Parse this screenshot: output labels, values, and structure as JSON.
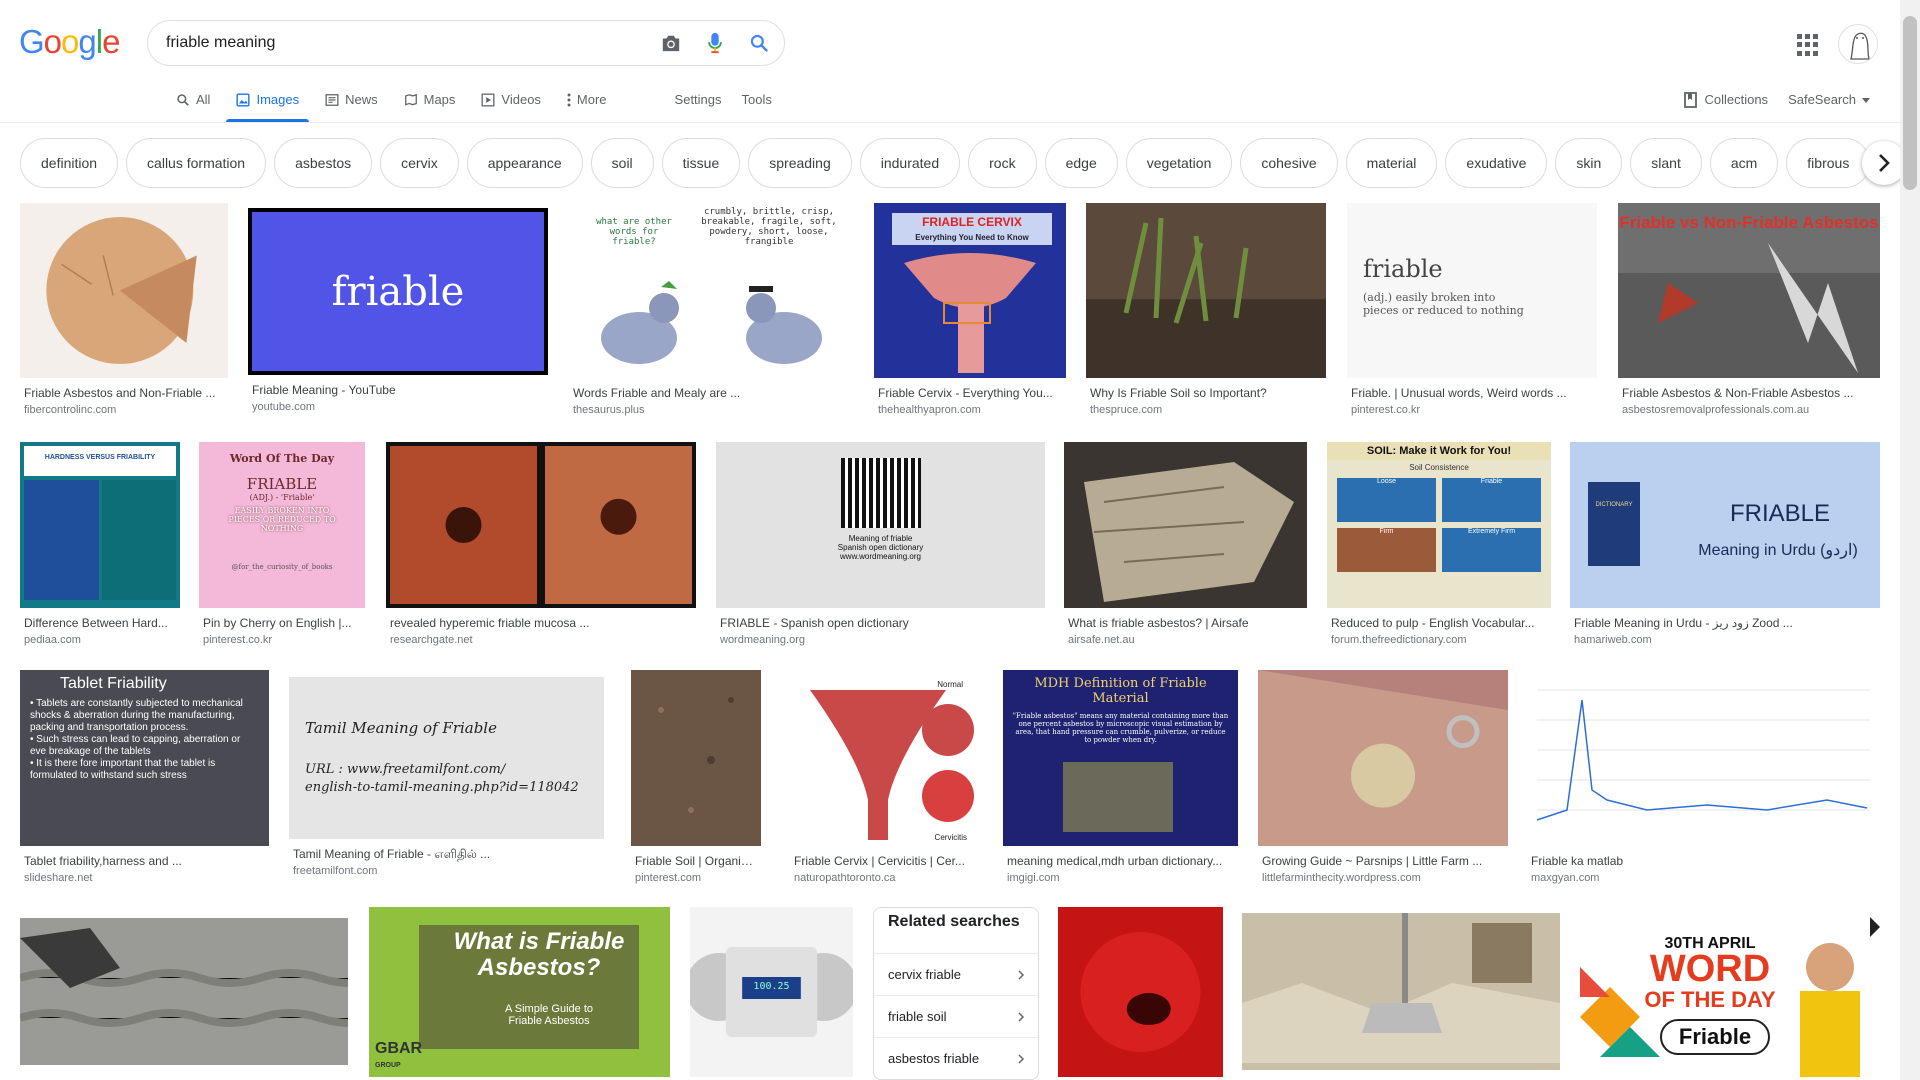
{
  "logo": {
    "letters": [
      "G",
      "o",
      "o",
      "g",
      "l",
      "e"
    ],
    "colors": [
      "#4285f4",
      "#ea4335",
      "#fbbc05",
      "#4285f4",
      "#34a853",
      "#ea4335"
    ]
  },
  "search": {
    "query": "friable meaning"
  },
  "icons": {
    "camera": "camera-icon",
    "mic": "mic-icon",
    "search": "search-icon",
    "apps": "apps-icon"
  },
  "tabs": [
    {
      "label": "All",
      "icon": "search-icon"
    },
    {
      "label": "Images",
      "icon": "image-icon",
      "active": true
    },
    {
      "label": "News",
      "icon": "news-icon"
    },
    {
      "label": "Maps",
      "icon": "map-icon"
    },
    {
      "label": "Videos",
      "icon": "video-icon"
    },
    {
      "label": "More",
      "icon": "more-vert-icon"
    }
  ],
  "tools": {
    "settings": "Settings",
    "tools": "Tools"
  },
  "header_right": {
    "collections": "Collections",
    "safesearch": "SafeSearch"
  },
  "chips": [
    "definition",
    "callus formation",
    "asbestos",
    "cervix",
    "appearance",
    "soil",
    "tissue",
    "spreading",
    "indurated",
    "rock",
    "edge",
    "vegetation",
    "cohesive",
    "material",
    "exudative",
    "skin",
    "slant",
    "acm",
    "fibrous"
  ],
  "results": [
    {
      "title": "Friable Asbestos and Non-Friable ...",
      "source": "fibercontrolinc.com",
      "bg": "#f1e3d3",
      "accent": "#d9a67a"
    },
    {
      "title": "Friable Meaning - YouTube",
      "source": "youtube.com",
      "bg": "#000000",
      "accent": "#5055e8",
      "label": "friable"
    },
    {
      "title": "Words Friable and Mealy are ...",
      "source": "thesaurus.plus",
      "bg": "#ffffff",
      "accent": "#9aa6c8",
      "lines": [
        "what are other words for friable?",
        "crumbly, brittle, crisp, breakable, fragile, soft, powdery, short, loose, frangible"
      ]
    },
    {
      "title": "Friable Cervix - Everything You...",
      "source": "thehealthyapron.com",
      "bg": "#22329a",
      "accent": "#e08a8a",
      "lines": [
        "FRIABLE CERVIX",
        "Everything You Need to Know"
      ]
    },
    {
      "title": "Why Is Friable Soil so Important?",
      "source": "thespruce.com",
      "bg": "#5b4a3c",
      "accent": "#6f8f3f"
    },
    {
      "title": "Friable. | Unusual words, Weird words ...",
      "source": "pinterest.co.kr",
      "bg": "#f7f7f7",
      "accent": "#444444",
      "lines": [
        "friable",
        "(adj.) easily broken into pieces or reduced to nothing"
      ]
    },
    {
      "title": "Friable Asbestos & Non-Friable Asbestos ...",
      "source": "asbestosremovalprofessionals.com.au",
      "bg": "#6f6f6f",
      "accent": "#d8d8d8",
      "lines": [
        "Friable vs Non-Friable Asbestos"
      ]
    },
    {
      "title": "Difference Between Hard...",
      "source": "pediaa.com",
      "bg": "#127a86",
      "accent": "#1f4f9a",
      "lines": [
        "HARDNESS VERSUS FRIABILITY"
      ]
    },
    {
      "title": "Pin by Cherry on English |...",
      "source": "pinterest.co.kr",
      "bg": "#f4b8d8",
      "accent": "#6b2a2a",
      "lines": [
        "Word Of The Day",
        "FRIABLE",
        "(ADJ.) - 'Friable'",
        "EASILY BROKEN INTO PIECES OR REDUCED TO NOTHING",
        "@for_the_curiosity_of_books"
      ]
    },
    {
      "title": "revealed hyperemic friable mucosa ...",
      "source": "researchgate.net",
      "bg": "#111111",
      "accent": "#c05a3a"
    },
    {
      "title": "FRIABLE - Spanish open dictionary",
      "source": "wordmeaning.org",
      "bg": "#e2e2e2",
      "accent": "#111111",
      "lines": [
        "Meaning of friable",
        "Spanish open dictionary",
        "www.wordmeaning.org"
      ]
    },
    {
      "title": "What is friable asbestos? | Airsafe",
      "source": "airsafe.net.au",
      "bg": "#b8ab93",
      "accent": "#7a6a55"
    },
    {
      "title": "Reduced to pulp - English Vocabular...",
      "source": "forum.thefreedictionary.com",
      "bg": "#e9e4cc",
      "accent": "#2b6fb0",
      "lines": [
        "SOIL: Make it Work for You!",
        "Soil Consistence",
        "Loose",
        "Friable",
        "Firm",
        "Extremely Firm"
      ]
    },
    {
      "title": "Friable Meaning in Urdu - زود ریز Zood ...",
      "source": "hamariweb.com",
      "bg": "#b9d0ef",
      "accent": "#1f3b7a",
      "lines": [
        "FRIABLE",
        "Meaning in Urdu (اردو)",
        "DICTIONARY"
      ]
    },
    {
      "title": "Tablet friability,harness and ...",
      "source": "slideshare.net",
      "bg": "#4a4a52",
      "accent": "#ffffff",
      "lines": [
        "Tablet Friability",
        "Tablets are constantly subjected to mechanical shocks & aberration during the manufacturing, packing and transportation process.",
        "Such stress can lead to capping, aberration or eve breakage of the tablets",
        "It is there fore important that the tablet is formulated to withstand such stress"
      ]
    },
    {
      "title": "Tamil Meaning of Friable - எளிதில் ...",
      "source": "freetamilfont.com",
      "bg": "#e5e5e5",
      "accent": "#222222",
      "lines": [
        "Tamil Meaning of Friable",
        "URL : www.freetamilfont.com/",
        "english-to-tamil-meaning.php?id=118042"
      ]
    },
    {
      "title": "Friable Soil | Organic ...",
      "source": "pinterest.com",
      "bg": "#6b5646",
      "accent": "#8a715c"
    },
    {
      "title": "Friable Cervix | Cervicitis | Cer...",
      "source": "naturopathtoronto.ca",
      "bg": "#ffffff",
      "accent": "#c94848",
      "lines": [
        "Normal",
        "Cervicitis"
      ]
    },
    {
      "title": "meaning medical,mdh urban dictionary...",
      "source": "imgigi.com",
      "bg": "#1e2270",
      "accent": "#f0d26b",
      "lines": [
        "MDH Definition of Friable Material",
        "\"Friable asbestos\" means any material containing more than one percent asbestos by microscopic visual estimation by area, that hand pressure can crumble, pulverize, or reduce to powder when dry."
      ]
    },
    {
      "title": "Growing Guide ~ Parsnips | Little Farm ...",
      "source": "littlefarminthecity.wordpress.com",
      "bg": "#b6807b",
      "accent": "#d8c9a2"
    },
    {
      "title": "Friable ka matlab",
      "source": "maxgyan.com",
      "bg": "#ffffff",
      "accent": "#2c6fd6"
    },
    {
      "title": "",
      "source": "",
      "bg": "#9a9a96",
      "accent": "#3a3a3a"
    },
    {
      "title": "",
      "source": "",
      "bg": "#8fc03e",
      "accent": "#ffffff",
      "lines": [
        "What is Friable Asbestos?",
        "A Simple Guide to Friable Asbestos",
        "GBAR",
        "GROUP"
      ]
    },
    {
      "title": "",
      "source": "",
      "bg": "#f3f3f3",
      "accent": "#1c3f8a",
      "lines": [
        "100.25"
      ]
    },
    {
      "title": "",
      "source": "",
      "bg": "#c41414",
      "accent": "#3a0505"
    },
    {
      "title": "",
      "source": "",
      "bg": "#c9bfa9",
      "accent": "#8a7a62"
    },
    {
      "title": "",
      "source": "",
      "bg": "#ffffff",
      "accent": "#e53b1f",
      "lines": [
        "30TH APRIL",
        "WORD",
        "OF THE DAY",
        "Friable"
      ]
    }
  ],
  "related": {
    "title": "Related searches",
    "items": [
      "cervix friable",
      "friable soil",
      "asbestos friable"
    ]
  }
}
